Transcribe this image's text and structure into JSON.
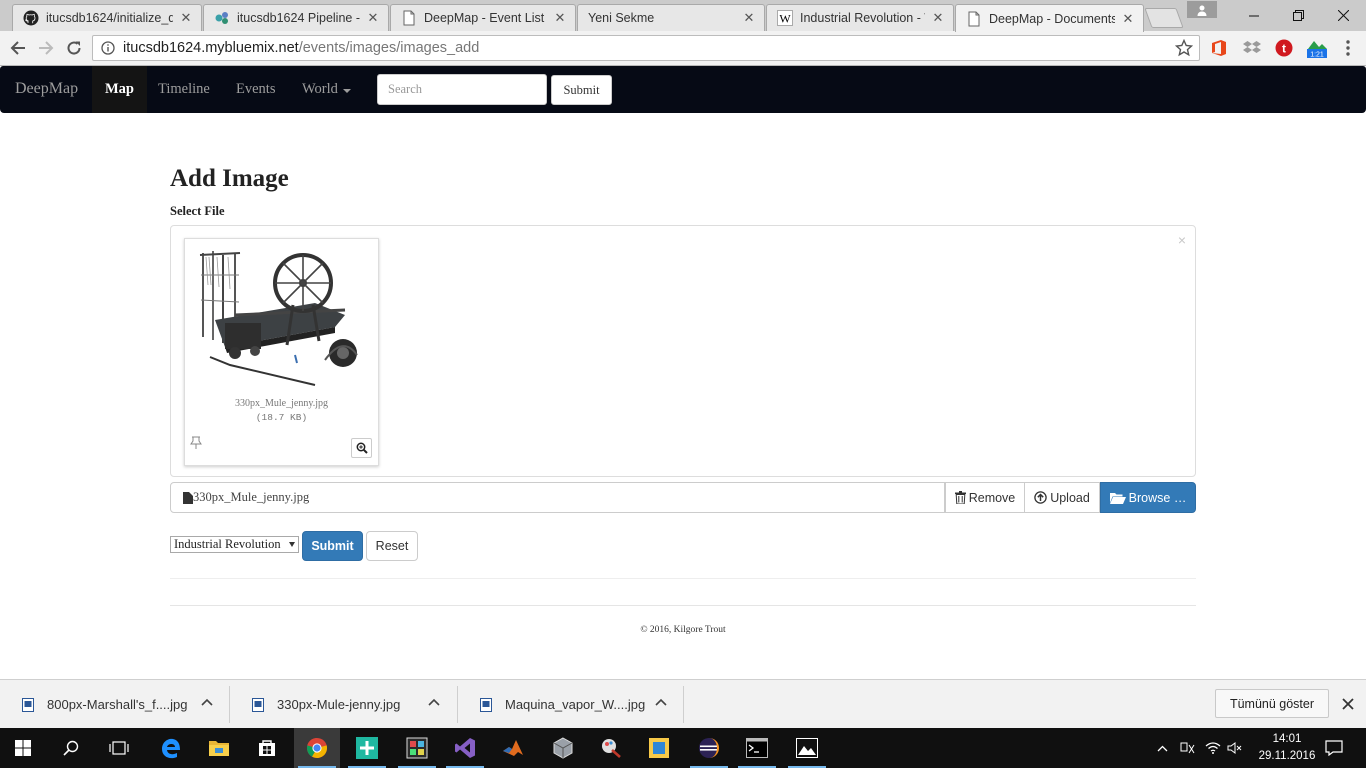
{
  "browser": {
    "tabs": [
      {
        "title": "itucsdb1624/initialize_d",
        "icon": "github-icon"
      },
      {
        "title": "itucsdb1624 Pipeline - I",
        "icon": "bluemix-icon"
      },
      {
        "title": "DeepMap - Event List",
        "icon": "page-icon"
      },
      {
        "title": "Yeni Sekme",
        "icon": "none"
      },
      {
        "title": "Industrial Revolution - W",
        "icon": "wikipedia-icon"
      },
      {
        "title": "DeepMap - Documents",
        "icon": "page-icon",
        "active": true
      }
    ],
    "address": {
      "host": "itucsdb1624.mybluemix.net",
      "path": "/events/images/images_add"
    },
    "extension_badge": "1:21"
  },
  "navbar": {
    "brand": "DeepMap",
    "items": [
      {
        "label": "Map",
        "active": true
      },
      {
        "label": "Timeline"
      },
      {
        "label": "Events"
      },
      {
        "label": "World"
      }
    ],
    "search_placeholder": "Search",
    "submit_label": "Submit"
  },
  "page": {
    "heading": "Add Image",
    "field_label": "Select File",
    "preview": {
      "filename": "330px_Mule_jenny.jpg",
      "size": "(18.7 KB)",
      "close_glyph": "×"
    },
    "file_caption": "330px_Mule_jenny.jpg",
    "buttons": {
      "remove": "Remove",
      "upload": "Upload",
      "browse": "Browse …"
    },
    "select": {
      "selected": "Industrial Revolution"
    },
    "submit_label": "Submit",
    "reset_label": "Reset",
    "footer": "© 2016, Kilgore Trout"
  },
  "downloads": {
    "items": [
      {
        "name": "800px-Marshall's_f....jpg"
      },
      {
        "name": "330px-Mule-jenny.jpg"
      },
      {
        "name": "Maquina_vapor_W....jpg"
      }
    ],
    "show_all": "Tümünü göster"
  },
  "taskbar": {
    "time": "14:01",
    "date": "29.11.2016"
  },
  "colors": {
    "navbar_bg": "#060a15",
    "primary_button": "#337ab7",
    "taskbar_bg": "#101010"
  }
}
